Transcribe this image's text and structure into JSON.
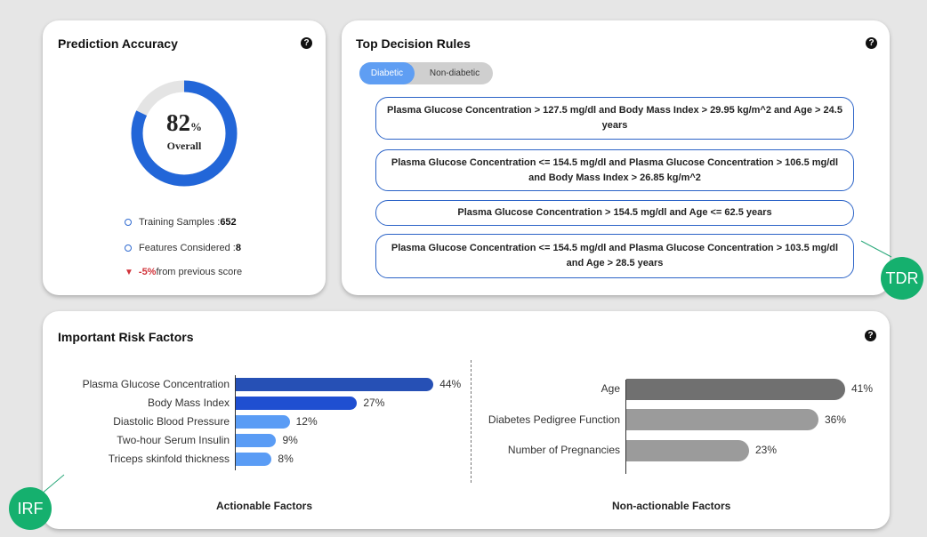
{
  "accuracy": {
    "title": "Prediction Accuracy",
    "value": "82",
    "unit": "%",
    "overall_label": "Overall",
    "gauge_fraction": 0.82,
    "training_label": "Training Samples : ",
    "training_value": "652",
    "features_label": "Features Considered : ",
    "features_value": "8",
    "change_value": "-5%",
    "change_text": " from previous score"
  },
  "rules": {
    "title": "Top Decision Rules",
    "tabs": [
      "Diabetic",
      "Non-diabetic"
    ],
    "items": [
      "Plasma Glucose Concentration > 127.5 mg/dl and Body Mass Index > 29.95 kg/m^2 and Age > 24.5 years",
      "Plasma Glucose Concentration <= 154.5 mg/dl and Plasma Glucose Concentration > 106.5 mg/dl and Body Mass Index > 26.85 kg/m^2",
      "Plasma Glucose Concentration > 154.5 mg/dl and Age <= 62.5 years",
      "Plasma Glucose Concentration <= 154.5 mg/dl and Plasma Glucose Concentration > 103.5 mg/dl and Age > 28.5 years"
    ]
  },
  "risk": {
    "title": "Important Risk Factors",
    "actionable_title": "Actionable Factors",
    "nonactionable_title": "Non-actionable Factors",
    "actionable": [
      {
        "label": "Plasma Glucose Concentration",
        "value": 44,
        "text": "44%",
        "color": "#2650b5"
      },
      {
        "label": "Body Mass Index",
        "value": 27,
        "text": "27%",
        "color": "#1f4fd1"
      },
      {
        "label": "Diastolic Blood Pressure",
        "value": 12,
        "text": "12%",
        "color": "#5a9cf5"
      },
      {
        "label": "Two-hour Serum Insulin",
        "value": 9,
        "text": "9%",
        "color": "#5a9cf5"
      },
      {
        "label": "Triceps skinfold thickness",
        "value": 8,
        "text": "8%",
        "color": "#5a9cf5"
      }
    ],
    "nonactionable": [
      {
        "label": "Age",
        "value": 41,
        "text": "41%",
        "color": "#707070"
      },
      {
        "label": "Diabetes Pedigree Function",
        "value": 36,
        "text": "36%",
        "color": "#9b9b9b"
      },
      {
        "label": "Number of Pregnancies",
        "value": 23,
        "text": "23%",
        "color": "#9b9b9b"
      }
    ]
  },
  "badges": {
    "tdr": "TDR",
    "irf": "IRF"
  },
  "help_icon": "?"
}
